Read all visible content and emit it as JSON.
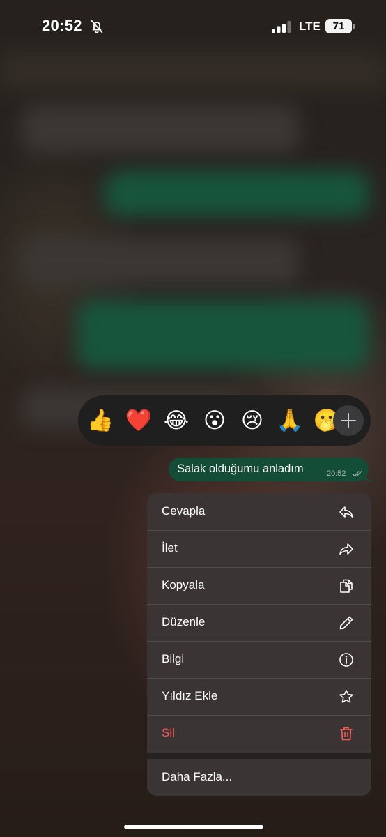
{
  "status_bar": {
    "time": "20:52",
    "network": "LTE",
    "battery": "71",
    "icons": [
      "bell-slash-icon",
      "signal-icon"
    ]
  },
  "reactions": {
    "emojis": [
      "👍",
      "❤️",
      "😂",
      "😮",
      "😢",
      "🙏",
      "🫢"
    ],
    "add_icon": "plus-icon"
  },
  "message": {
    "text": "Salak olduğumu anladım",
    "time": "20:52",
    "status_icon": "double-check-icon",
    "bubble_color": "#144d37"
  },
  "menu": {
    "items": [
      {
        "label": "Cevapla",
        "icon": "reply-icon"
      },
      {
        "label": "İlet",
        "icon": "forward-icon"
      },
      {
        "label": "Kopyala",
        "icon": "copy-icon"
      },
      {
        "label": "Düzenle",
        "icon": "pencil-icon"
      },
      {
        "label": "Bilgi",
        "icon": "info-icon"
      },
      {
        "label": "Yıldız Ekle",
        "icon": "star-icon"
      },
      {
        "label": "Sil",
        "icon": "trash-icon",
        "color": "#ff5b5b"
      }
    ],
    "more_label": "Daha Fazla..."
  }
}
